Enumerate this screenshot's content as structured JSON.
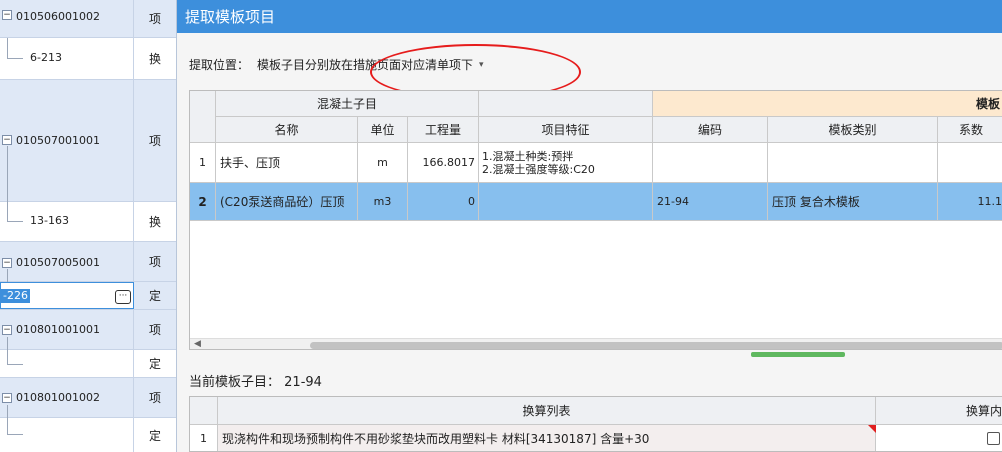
{
  "left_panel": {
    "rows": [
      {
        "code": "010506001002",
        "type": "项"
      },
      {
        "code": "6-213",
        "type": "换"
      },
      {
        "code": "010507001001",
        "type": "项"
      },
      {
        "code": "13-163",
        "type": "换"
      },
      {
        "code": "010507005001",
        "type": "项"
      },
      {
        "code": "-226",
        "type": "定"
      },
      {
        "code": "010801001001",
        "type": "项"
      },
      {
        "code": "",
        "type": "定"
      },
      {
        "code": "010801001002",
        "type": "项"
      },
      {
        "code": "",
        "type": "定"
      }
    ]
  },
  "dialog": {
    "title": "提取模板项目",
    "position_label": "提取位置：",
    "position_value": "模板子目分别放在措施页面对应清单项下",
    "grid": {
      "group_headers": [
        "混凝土子目",
        "模板"
      ],
      "headers": [
        "名称",
        "单位",
        "工程量",
        "项目特征",
        "编码",
        "模板类别",
        "系数"
      ],
      "rows": [
        {
          "num": "1",
          "name": "扶手、压顶",
          "unit": "m",
          "qty": "166.8017",
          "feature1": "1.混凝土种类:预拌",
          "feature2": "2.混凝土强度等级:C20",
          "code": "",
          "category": "",
          "coef": ""
        },
        {
          "num": "2",
          "name": "(C20泵送商品砼）压顶",
          "unit": "m3",
          "qty": "0",
          "feature1": "",
          "feature2": "",
          "code": "21-94",
          "category": "压顶 复合木模板",
          "coef": "11.1"
        }
      ]
    },
    "current_label": "当前模板子目：",
    "current_value": "21-94",
    "conv": {
      "headers": [
        "换算列表",
        "换算内"
      ],
      "rows": [
        {
          "num": "1",
          "text": "现浇构件和现场预制构件不用砂浆垫块而改用塑料卡 材料[34130187] 含量+30",
          "checked": false
        }
      ]
    }
  }
}
